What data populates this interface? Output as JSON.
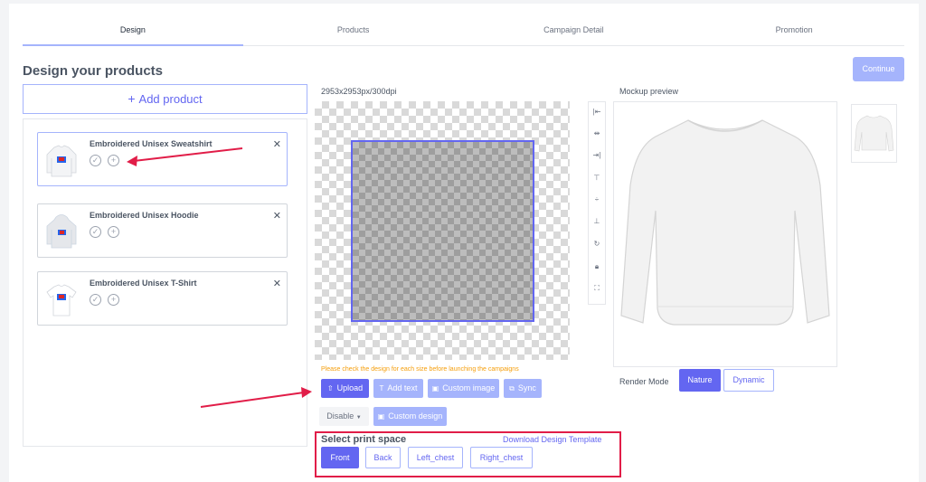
{
  "tabs": [
    {
      "label": "Design",
      "active": true
    },
    {
      "label": "Products",
      "active": false
    },
    {
      "label": "Campaign Detail",
      "active": false
    },
    {
      "label": "Promotion",
      "active": false
    }
  ],
  "page_title": "Design your products",
  "continue_label": "Continue",
  "add_product_label": "Add product",
  "products": [
    {
      "name": "Embroidered Unisex Sweatshirt",
      "selected": true
    },
    {
      "name": "Embroidered Unisex Hoodie",
      "selected": false
    },
    {
      "name": "Embroidered Unisex T-Shirt",
      "selected": false
    }
  ],
  "canvas": {
    "dimensions": "2953x2953px/300dpi"
  },
  "toolbar_icons": [
    "align-left-icon",
    "align-center-h-icon",
    "align-right-icon",
    "align-top-icon",
    "align-middle-v-icon",
    "align-bottom-icon",
    "rotate-icon",
    "lock-icon",
    "fit-icon"
  ],
  "warning": "Please check the design for each size before launching the campaigns",
  "actions": {
    "upload": "Upload",
    "add_text": "Add text",
    "custom_image": "Custom image",
    "sync": "Sync",
    "disable": "Disable",
    "custom_design": "Custom design"
  },
  "print_space": {
    "title": "Select print space",
    "download_link": "Download Design Template",
    "options": [
      "Front",
      "Back",
      "Left_chest",
      "Right_chest"
    ],
    "selected": "Front"
  },
  "mockup": {
    "label": "Mockup preview"
  },
  "render_mode": {
    "label": "Render Mode",
    "options": [
      "Nature",
      "Dynamic"
    ],
    "selected": "Nature"
  },
  "colors": {
    "accent": "#6366f1",
    "accent_light": "#a5b4fc",
    "warning": "#f59e0b",
    "highlight": "#e11d48"
  }
}
